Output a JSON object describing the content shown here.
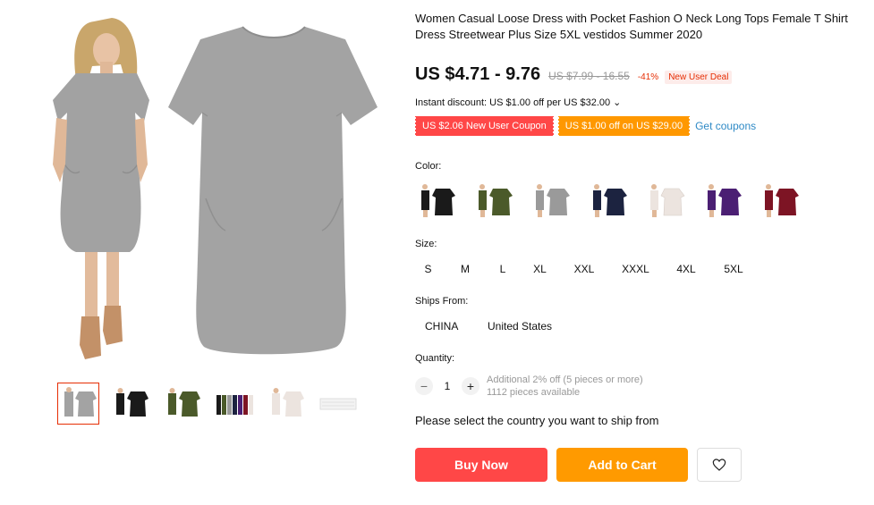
{
  "gallery": {
    "main_image": "grey-dress-model-and-flat",
    "thumbnails": [
      {
        "name": "thumb-grey-dress",
        "active": true
      },
      {
        "name": "thumb-black-dress",
        "active": false
      },
      {
        "name": "thumb-green-dress",
        "active": false
      },
      {
        "name": "thumb-all-colors",
        "active": false
      },
      {
        "name": "thumb-white-dress",
        "active": false
      },
      {
        "name": "thumb-size-chart",
        "active": false
      }
    ]
  },
  "product": {
    "title": "Women Casual Loose Dress with Pocket Fashion O Neck Long Tops Female T Shirt Dress Streetwear Plus Size 5XL vestidos Summer 2020",
    "price": "US $4.71 - 9.76",
    "original_price": "US $7.99 - 16.55",
    "discount": "-41%",
    "deal_badge": "New User Deal",
    "instant_discount": "Instant discount: US $1.00 off per US $32.00",
    "instant_discount_chevron": "⌄",
    "coupon_new_user": "US $2.06 New User Coupon",
    "coupon_store": "US $1.00 off on US $29.00",
    "get_coupons": "Get coupons"
  },
  "options": {
    "color_label": "Color:",
    "colors": [
      {
        "name": "black",
        "hex": "#1a1a1a"
      },
      {
        "name": "army-green",
        "hex": "#4b5a2a"
      },
      {
        "name": "grey",
        "hex": "#9a9a9a"
      },
      {
        "name": "navy",
        "hex": "#1c2340"
      },
      {
        "name": "white",
        "hex": "#ece4df"
      },
      {
        "name": "purple",
        "hex": "#4b1f73"
      },
      {
        "name": "wine-red",
        "hex": "#7d1424"
      }
    ],
    "size_label": "Size:",
    "sizes": [
      "S",
      "M",
      "L",
      "XL",
      "XXL",
      "XXXL",
      "4XL",
      "5XL"
    ],
    "ships_label": "Ships From:",
    "ships_from": [
      "CHINA",
      "United States"
    ],
    "quantity_label": "Quantity:",
    "quantity": "1",
    "qty_minus": "−",
    "qty_plus": "+",
    "qty_note_1": "Additional 2% off (5 pieces or more)",
    "qty_note_2": "1112 pieces available"
  },
  "shipping_message": "Please select the country you want to ship from",
  "actions": {
    "buy_now": "Buy Now",
    "add_to_cart": "Add to Cart",
    "wishlist_icon": "heart-icon"
  },
  "colors_theme": {
    "accent_red": "#ff4747",
    "accent_orange": "#ff9a00",
    "link_blue": "#2f8ac6",
    "dress_grey": "#a2a2a2"
  }
}
